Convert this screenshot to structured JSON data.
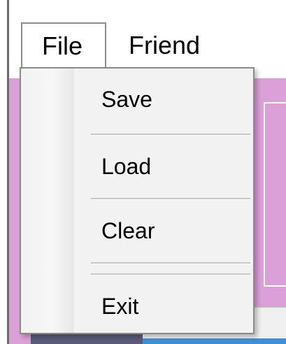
{
  "menubar": {
    "items": [
      {
        "label": "File"
      },
      {
        "label": "Friend"
      }
    ]
  },
  "file_menu": {
    "items": [
      {
        "label": "Save"
      },
      {
        "label": "Load"
      },
      {
        "label": "Clear"
      },
      {
        "label": "Exit"
      }
    ]
  },
  "colors": {
    "form_background": "#dca0d8",
    "menu_background": "#f2f2f2",
    "menu_border": "#8a8a8a",
    "separator": "#c8c8c8"
  }
}
